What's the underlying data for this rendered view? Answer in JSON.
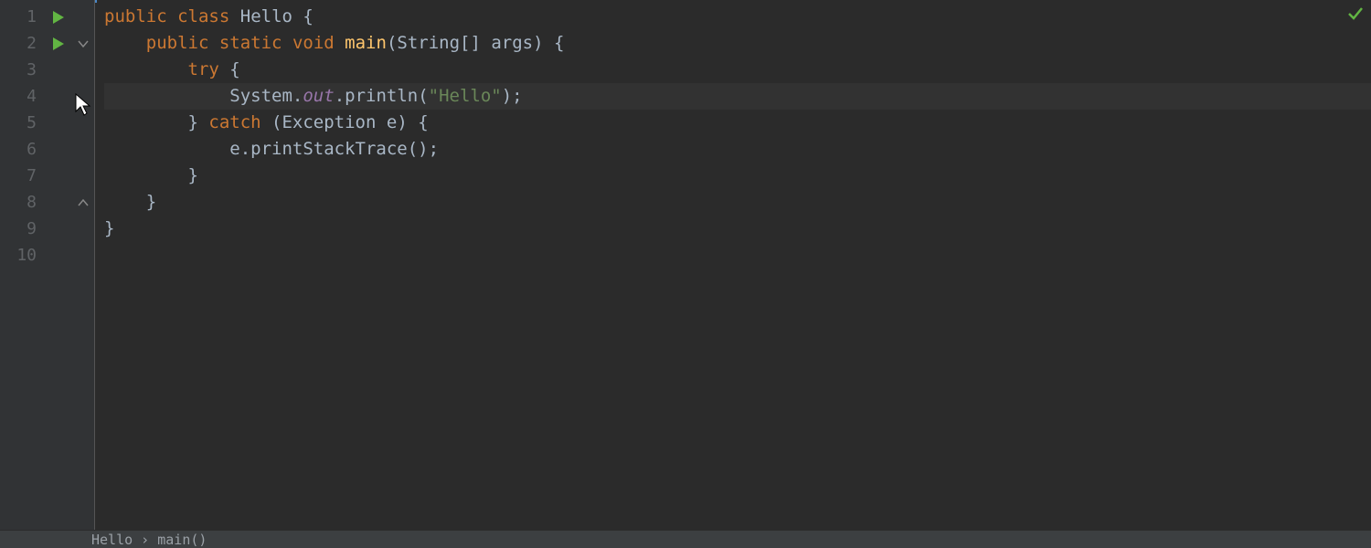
{
  "lineCount": 10,
  "currentLine": 4,
  "breadcrumb": "Hello › main()",
  "code": {
    "l1": {
      "kw1": "public",
      "kw2": "class",
      "cls": "Hello",
      "open": " {"
    },
    "l2": {
      "indent": "    ",
      "kw1": "public",
      "kw2": "static",
      "kw3": "void",
      "mth": "main",
      "args": "(String[] args) {"
    },
    "l3": {
      "indent": "        ",
      "kw": "try",
      "open": " {"
    },
    "l4": {
      "indent": "            ",
      "sys": "System.",
      "out": "out",
      "rest1": ".println(",
      "str": "\"Hello\"",
      "rest2": ");"
    },
    "l5": {
      "indent": "        ",
      "close": "} ",
      "kw": "catch",
      "args": " (Exception e) {"
    },
    "l6": {
      "indent": "            ",
      "text": "e.printStackTrace();"
    },
    "l7": {
      "indent": "        ",
      "close": "}"
    },
    "l8": {
      "indent": "    ",
      "close": "}"
    },
    "l9": {
      "close": "}"
    }
  }
}
